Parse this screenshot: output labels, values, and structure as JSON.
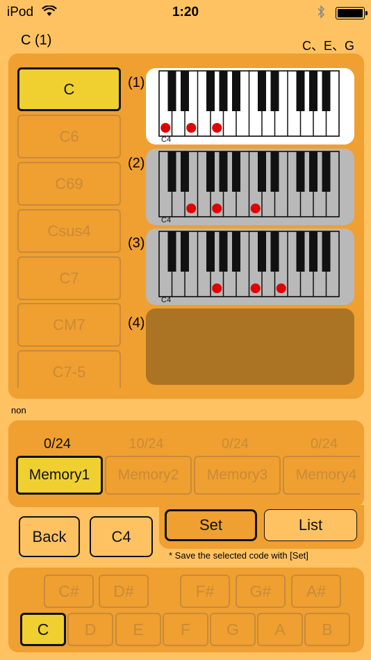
{
  "status_bar": {
    "carrier": "iPod",
    "time": "1:20"
  },
  "header": {
    "chord_title": "C (1)",
    "notes": "C、E、G"
  },
  "chords": [
    "C",
    "C6",
    "C69",
    "Csus4",
    "C7",
    "CM7",
    "C7-5"
  ],
  "voicings": [
    {
      "label": "(1)",
      "octave_label": "C4",
      "state": "selected",
      "dots": [
        "C",
        "E",
        "G"
      ]
    },
    {
      "label": "(2)",
      "octave_label": "C4",
      "state": "unselected",
      "dots": [
        "E",
        "G",
        "C+"
      ]
    },
    {
      "label": "(3)",
      "octave_label": "C4",
      "state": "unselected",
      "dots": [
        "G",
        "C+",
        "E+"
      ]
    },
    {
      "label": "(4)",
      "state": "empty"
    }
  ],
  "status_text": "non",
  "memories": [
    {
      "label": "Memory1",
      "count": "0/24",
      "selected": true
    },
    {
      "label": "Memory2",
      "count": "10/24",
      "selected": false
    },
    {
      "label": "Memory3",
      "count": "0/24",
      "selected": false
    },
    {
      "label": "Memory4",
      "count": "0/24",
      "selected": false
    }
  ],
  "controls": {
    "back_label": "Back",
    "octave_label": "C4",
    "set_label": "Set",
    "list_label": "List",
    "hint": "* Save the selected code with [Set]"
  },
  "keys": {
    "sharps": [
      "C#",
      "D#",
      "F#",
      "G#",
      "A#"
    ],
    "naturals": [
      "C",
      "D",
      "E",
      "F",
      "G",
      "A",
      "B"
    ],
    "selected": "C"
  },
  "colors": {
    "background": "#ffc262",
    "panel": "#efa030",
    "selected": "#efd030",
    "dot": "#e00000",
    "empty_slot": "#aa7424"
  }
}
